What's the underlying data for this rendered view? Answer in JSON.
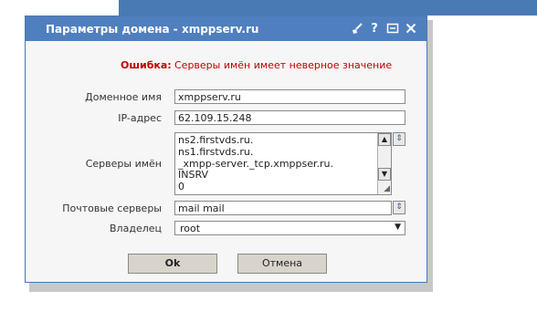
{
  "dialog": {
    "title": "Параметры домена - xmppserv.ru",
    "icons": [
      "broom-icon",
      "help-icon",
      "maximize-icon",
      "close-icon"
    ]
  },
  "error": {
    "label": "Ошибка:",
    "message": "Серверы имён имеет неверное значение"
  },
  "form": {
    "domain_label": "Доменное имя",
    "domain_value": "xmppserv.ru",
    "ip_label": "IP-адрес",
    "ip_value": "62.109.15.248",
    "ns_label": "Серверы имён",
    "ns_values": [
      "ns2.firstvds.ru.",
      "ns1.firstvds.ru.",
      "_xmpp-server._tcp.xmppser.ru.",
      "INSRV",
      "0"
    ],
    "mail_label": "Почтовые серверы",
    "mail_value": "mail mail",
    "owner_label": "Владелец",
    "owner_value": "root"
  },
  "buttons": {
    "ok": "Ok",
    "cancel": "Отмена"
  },
  "colors": {
    "titlebar": "#4f7fbf",
    "error": "#c00000"
  }
}
